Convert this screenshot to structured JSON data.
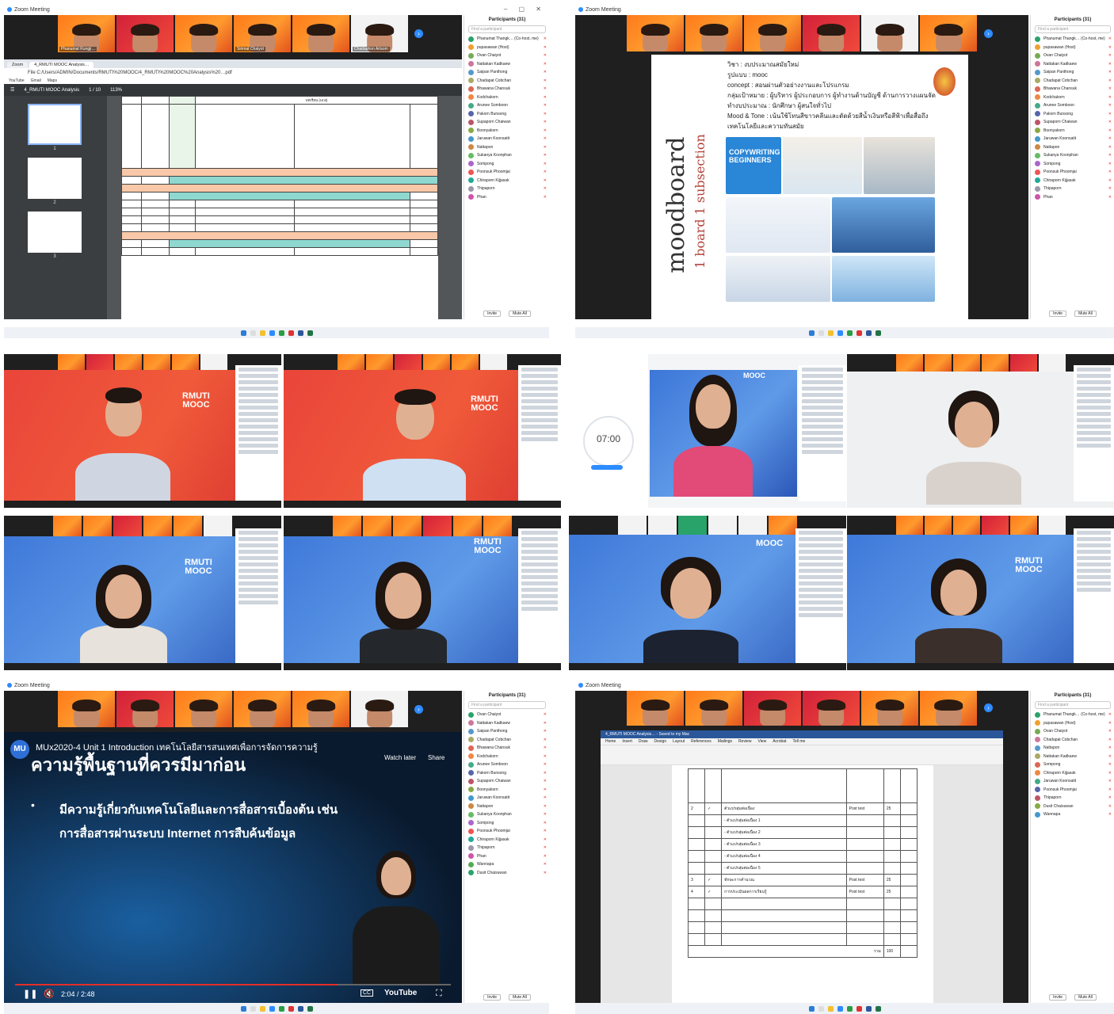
{
  "app": {
    "window_title": "Zoom Meeting",
    "participants_title": "Participants (31)",
    "search_placeholder": "Find a participant",
    "invite_label": "Invite",
    "mute_all_label": "Mute All",
    "more_label": "..."
  },
  "colors": {
    "zoom_blue": "#2d8cff",
    "orange_bg": "#ff7a1a",
    "red_bg": "#e9443a",
    "blue_bg": "#3c76d8",
    "muted_red": "#dd3333"
  },
  "icons": [
    "zoom-icon",
    "next-page-icon",
    "search-icon",
    "mic-muted-icon",
    "video-off-icon",
    "windows-start-icon",
    "play-pause-icon",
    "volume-icon",
    "captions-icon",
    "fullscreen-icon"
  ],
  "gallery_names": [
    "Phanumat Rungji…",
    "",
    "",
    "Sirimat Chaiyot",
    "",
    "Chadaphon Artsom"
  ],
  "participants": [
    "Phanumat Thangk… (Co-host, me)",
    "pupasawan (Host)",
    "Ovan Chaiyot",
    "Nattakan Kadkaew",
    "Saipan Panthong",
    "Chadapat Cobchan",
    "Bhawana Chansuk",
    "Kodchakorn",
    "Arunee Somboon",
    "Pakorn Bunsong",
    "Supaporn Chaiwan",
    "Boonyakorn",
    "Jaruwan Koonsatit",
    "Nattapon",
    "Sukanya Koonphan",
    "Sompong",
    "Poonsuk Phoomjai",
    "Chiraporn Kijjasak",
    "Thipaporn",
    "Phan",
    "Wannapa",
    "Dusit Chaisuwan"
  ],
  "pdf": {
    "tabs": [
      "Zoom",
      "4_RMUTI MOOC Analysis…"
    ],
    "address": "File  C:/Users/ADMIN/Documents/RMUTI%20MOOC/4_RMUTI%20MOOC%20Analysis%20…pdf",
    "bookmarks": [
      "YouTube",
      "Gmail",
      "Maps"
    ],
    "file_title": "4_RMUTI MOOC Analysis",
    "page_indicator": "1 / 10",
    "zoom": "113%",
    "thumb_labels": [
      "1",
      "2",
      "3"
    ],
    "table_header": "บทเรียน (Unit)"
  },
  "moodboard": {
    "big_title": "moodboard",
    "sub_title": "1 board 1 subsection",
    "lines": [
      "วิชา : งบประมาณสมัยใหม่",
      "รูปแบบ : mooc",
      "concept : สอนผ่านตัวอย่างงานและโปรแกรม",
      "กลุ่มเป้าหมาย : ผู้บริหาร ผู้ประกอบการ ผู้ทำงานด้านบัญชี ด้านการวางแผนจัด",
      "ทำงบประมาณ : นักศึกษา ผู้สนใจทั่วไป",
      "Mood & Tone : เน้นใช้โทนสีขาวคลีนและตัดด้วยสีน้ำเงินหรือสีฟ้าเพื่อสื่อถึง",
      "เทคโนโลยีและความทันสมัย"
    ],
    "banner": "COPYWRITING BEGINNERS"
  },
  "rmuti_logo": [
    "RMUTI",
    "MOOC"
  ],
  "timer": "07:00",
  "youtube": {
    "video_title": "MUx2020-4 Unit 1 Introduction เทคโนโลยีสารสนเทศเพื่อการจัดการความรู้",
    "heading": "ความรู้พื้นฐานที่ควรมีมาก่อน",
    "bullet_1": "มีความรู้เกี่ยวกับเทคโนโลยีและการสื่อสารเบื้องต้น เช่น",
    "bullet_2": "การสื่อสารผ่านระบบ Internet การสืบค้นข้อมูล",
    "watch_later": "Watch later",
    "share": "Share",
    "time": "2:04 / 2:48",
    "logo": "YouTube",
    "progress": 0.74
  },
  "word": {
    "title": "4_RMUTI MOOC Analysis… - Saved to my Mac",
    "menu": [
      "Home",
      "Insert",
      "Draw",
      "Design",
      "Layout",
      "References",
      "Mailings",
      "Review",
      "View",
      "Acrobat",
      "Tell me"
    ],
    "rows": [
      {
        "no": "2",
        "check": "✓",
        "topic": "ตัวแปรสุ่มต่อเนื่อง",
        "type": "Post test",
        "score": "25"
      },
      {
        "no": "",
        "check": "",
        "topic": "- ตัวแปรสุ่มต่อเนื่อง 1",
        "type": "",
        "score": ""
      },
      {
        "no": "",
        "check": "",
        "topic": "- ตัวแปรสุ่มต่อเนื่อง 2",
        "type": "",
        "score": ""
      },
      {
        "no": "",
        "check": "",
        "topic": "- ตัวแปรสุ่มต่อเนื่อง 3",
        "type": "",
        "score": ""
      },
      {
        "no": "",
        "check": "",
        "topic": "- ตัวแปรสุ่มต่อเนื่อง 4",
        "type": "",
        "score": ""
      },
      {
        "no": "",
        "check": "",
        "topic": "- ตัวแปรสุ่มต่อเนื่อง 5",
        "type": "",
        "score": ""
      },
      {
        "no": "3",
        "check": "✓",
        "topic": "ทักษะการคำนวณ",
        "type": "Post test",
        "score": "25"
      },
      {
        "no": "4",
        "check": "✓",
        "topic": "การประเมินผลการเรียนรู้",
        "type": "Post test",
        "score": "25"
      }
    ],
    "total_label": "รวม",
    "total_value": "100"
  }
}
